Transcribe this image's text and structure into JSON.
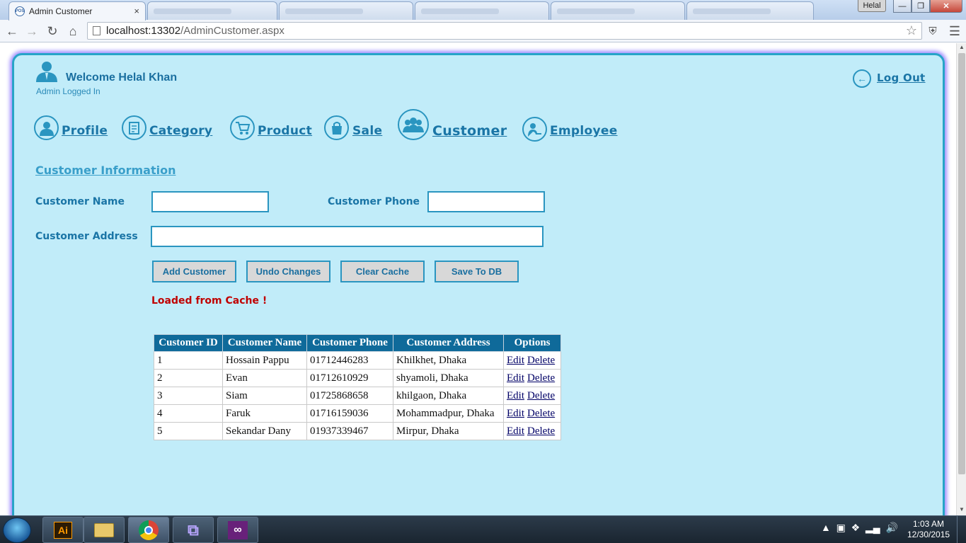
{
  "browser": {
    "active_tab_title": "Admin Customer",
    "tab_close": "×",
    "user_badge": "Helal",
    "window_minimize": "—",
    "window_restore": "❐",
    "window_close": "✕",
    "url_host": "localhost:13302",
    "url_path": "/AdminCustomer.aspx",
    "favicon_text": "POS"
  },
  "header": {
    "welcome": "Welcome Helal Khan",
    "role": "Admin Logged In",
    "logout": "Log Out"
  },
  "nav": {
    "profile": "Profile",
    "category": "Category",
    "product": "Product",
    "sale": "Sale",
    "customer": "Customer",
    "employee": "Employee"
  },
  "form": {
    "title": "Customer Information",
    "name_label": "Customer Name",
    "name_value": "",
    "phone_label": "Customer Phone",
    "phone_value": "",
    "address_label": "Customer Address",
    "address_value": ""
  },
  "buttons": {
    "add": "Add Customer",
    "undo": "Undo Changes",
    "clear": "Clear Cache",
    "save": "Save To DB"
  },
  "status": {
    "message": "Loaded from Cache !",
    "color": "#c00000"
  },
  "table": {
    "headers": [
      "Customer ID",
      "Customer Name",
      "Customer Phone",
      "Customer Address",
      "Options"
    ],
    "edit_label": "Edit",
    "delete_label": "Delete",
    "rows": [
      {
        "id": "1",
        "name": "Hossain Pappu",
        "phone": "01712446283",
        "address": "Khilkhet, Dhaka"
      },
      {
        "id": "2",
        "name": "Evan",
        "phone": "01712610929",
        "address": "shyamoli, Dhaka"
      },
      {
        "id": "3",
        "name": "Siam",
        "phone": "01725868658",
        "address": "khilgaon, Dhaka"
      },
      {
        "id": "4",
        "name": "Faruk",
        "phone": "01716159036",
        "address": "Mohammadpur, Dhaka"
      },
      {
        "id": "5",
        "name": "Sekandar Dany",
        "phone": "01937339467",
        "address": "Mirpur, Dhaka"
      }
    ]
  },
  "taskbar": {
    "time": "1:03 AM",
    "date": "12/30/2015",
    "illustrator_label": "Ai"
  },
  "colors": {
    "panel_bg": "#c1ecf9",
    "accent": "#2a95c0",
    "table_header": "#0f6a9a"
  }
}
